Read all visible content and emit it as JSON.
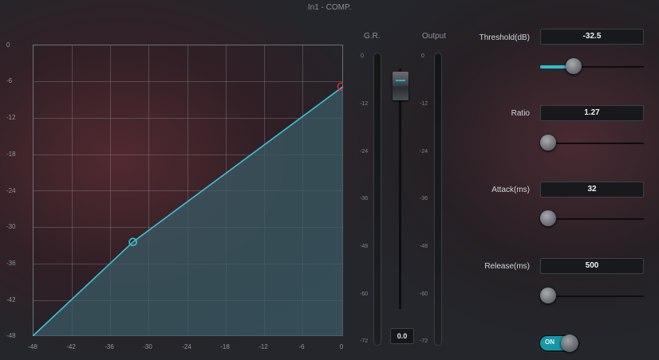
{
  "title": "In1 - COMP.",
  "graph": {
    "y_ticks": [
      "0",
      "-6",
      "-12",
      "-18",
      "-24",
      "-30",
      "-36",
      "-42",
      "-48"
    ],
    "x_ticks": [
      "-48",
      "-42",
      "-36",
      "-30",
      "-24",
      "-18",
      "-12",
      "-6",
      "0"
    ],
    "threshold_db": -32.5,
    "ratio": 1.27,
    "input_range": [
      -48,
      0
    ],
    "output_range": [
      -48,
      0
    ],
    "curve_color": "#3cc3d3",
    "fill_color": "#3a5d68",
    "threshold_point_color": "#3cc3d3",
    "end_point_color": "#e0242c"
  },
  "meters": {
    "gr_label": "G.R.",
    "output_label": "Output",
    "ticks": [
      "0",
      "-12",
      "-24",
      "-36",
      "-48",
      "-60",
      "-72"
    ]
  },
  "fader": {
    "value": "0.0"
  },
  "params": {
    "threshold": {
      "label": "Threshold(dB)",
      "value": "-32.5",
      "slider_fraction": 0.32
    },
    "ratio": {
      "label": "Ratio",
      "value": "1.27",
      "slider_fraction": 0.03
    },
    "attack": {
      "label": "Attack(ms)",
      "value": "32",
      "slider_fraction": 0.07
    },
    "release": {
      "label": "Release(ms)",
      "value": "500",
      "slider_fraction": 0.07
    }
  },
  "power": {
    "label": "ON",
    "state": "on"
  },
  "colors": {
    "accent": "#27c2d2"
  }
}
